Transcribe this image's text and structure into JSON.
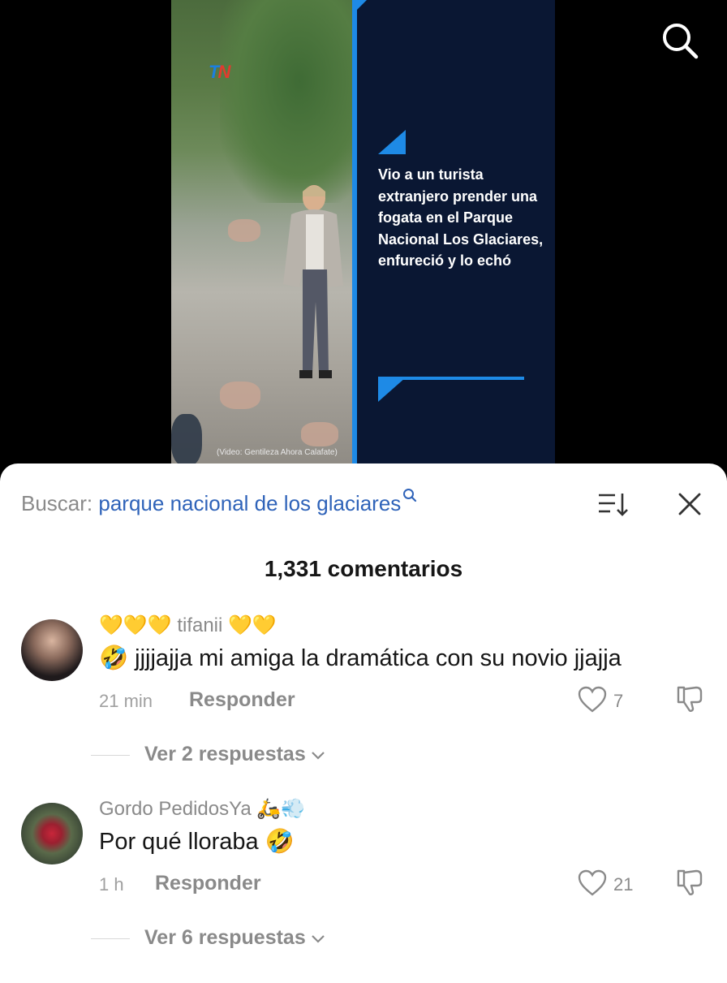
{
  "video": {
    "logo_tn": "TN",
    "headline": "Vio a un turista extranjero prender una fogata en el Parque Nacional Los Glaciares, enfureció y lo echó",
    "credit": "(Video: Gentileza Ahora Calafate)",
    "accent_color": "#1e8ae6",
    "panel_color": "#0a1733"
  },
  "comments_sheet": {
    "search_prefix": "Buscar:",
    "search_query": "parque nacional de los glaciares",
    "count_label": "1,331 comentarios",
    "comments": [
      {
        "author": "💛💛💛 tifanii 💛💛",
        "text": "🤣 jjjjajja mi amiga la dramática con su novio jjajja",
        "time": "21 min",
        "reply_label": "Responder",
        "likes": "7",
        "view_replies": "Ver 2 respuestas"
      },
      {
        "author": "Gordo PedidosYa 🛵💨",
        "text": "Por qué lloraba 🤣",
        "time": "1 h",
        "reply_label": "Responder",
        "likes": "21",
        "view_replies": "Ver 6 respuestas"
      }
    ]
  },
  "icons": [
    "search-icon",
    "sort-icon",
    "close-icon",
    "heart-icon",
    "dislike-icon",
    "chevron-down-icon"
  ]
}
